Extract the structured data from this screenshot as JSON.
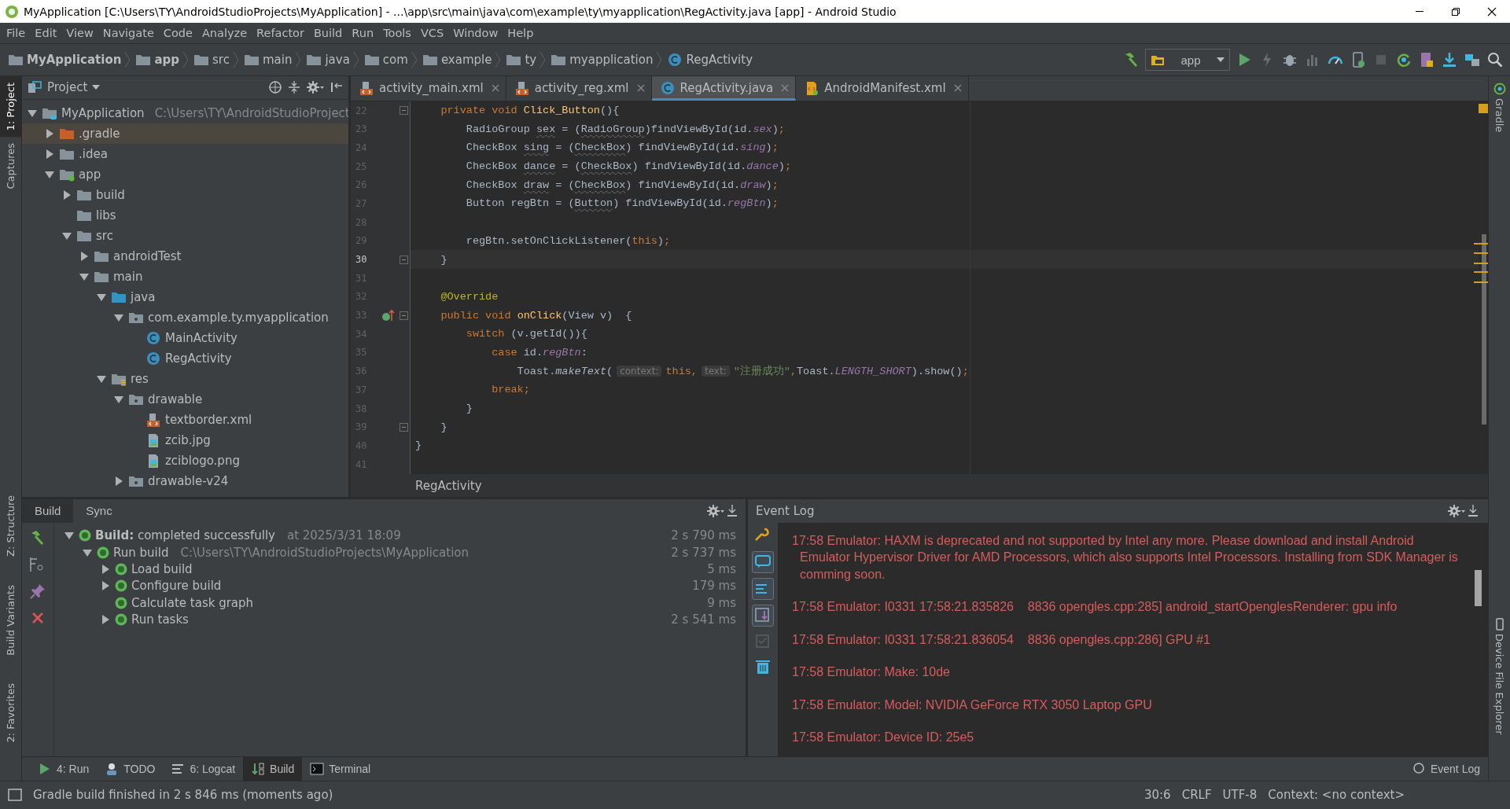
{
  "window": {
    "title": "MyApplication [C:\\Users\\TY\\AndroidStudioProjects\\MyApplication] - ...\\app\\src\\main\\java\\com\\example\\ty\\myapplication\\RegActivity.java [app] - Android Studio"
  },
  "menu": [
    "File",
    "Edit",
    "View",
    "Navigate",
    "Code",
    "Analyze",
    "Refactor",
    "Build",
    "Run",
    "Tools",
    "VCS",
    "Window",
    "Help"
  ],
  "breadcrumbs": [
    {
      "label": "MyApplication",
      "kind": "root"
    },
    {
      "label": "app",
      "kind": "module"
    },
    {
      "label": "src",
      "kind": "folder"
    },
    {
      "label": "main",
      "kind": "folder"
    },
    {
      "label": "java",
      "kind": "folder"
    },
    {
      "label": "com",
      "kind": "folder"
    },
    {
      "label": "example",
      "kind": "folder"
    },
    {
      "label": "ty",
      "kind": "folder"
    },
    {
      "label": "myapplication",
      "kind": "folder"
    },
    {
      "label": "RegActivity",
      "kind": "class"
    }
  ],
  "run_configuration": "app",
  "left_stripe": {
    "top": [
      {
        "label": "1: Project",
        "selected": true
      },
      {
        "label": "Captures",
        "selected": false
      }
    ],
    "bottom": [
      {
        "label": "Z: Structure",
        "selected": false
      },
      {
        "label": "Build Variants",
        "selected": false
      },
      {
        "label": "2: Favorites",
        "selected": false
      }
    ]
  },
  "right_stripe": [
    {
      "label": "Gradle"
    },
    {
      "label": "Device File Explorer"
    }
  ],
  "project": {
    "title": "Project",
    "tree": [
      {
        "label": "MyApplication",
        "path": "C:\\Users\\TY\\AndroidStudioProject",
        "kind": "root",
        "expanded": true,
        "selected": false,
        "children": [
          {
            "label": ".gradle",
            "kind": "folder-excluded",
            "expanded": false,
            "selected": true
          },
          {
            "label": ".idea",
            "kind": "folder",
            "expanded": false,
            "selected": false
          },
          {
            "label": "app",
            "kind": "module",
            "expanded": true,
            "selected": false,
            "children": [
              {
                "label": "build",
                "kind": "folder",
                "expanded": false,
                "selected": false
              },
              {
                "label": "libs",
                "kind": "folder",
                "selected": false
              },
              {
                "label": "src",
                "kind": "folder",
                "expanded": true,
                "selected": false,
                "children": [
                  {
                    "label": "androidTest",
                    "kind": "folder",
                    "expanded": false,
                    "selected": false
                  },
                  {
                    "label": "main",
                    "kind": "folder",
                    "expanded": true,
                    "selected": false,
                    "children": [
                      {
                        "label": "java",
                        "kind": "folder-source",
                        "expanded": true,
                        "selected": false,
                        "children": [
                          {
                            "label": "com.example.ty.myapplication",
                            "kind": "package",
                            "expanded": true,
                            "selected": false,
                            "children": [
                              {
                                "label": "MainActivity",
                                "kind": "class",
                                "selected": false
                              },
                              {
                                "label": "RegActivity",
                                "kind": "class",
                                "selected": false
                              }
                            ]
                          }
                        ]
                      },
                      {
                        "label": "res",
                        "kind": "folder-res",
                        "expanded": true,
                        "selected": false,
                        "children": [
                          {
                            "label": "drawable",
                            "kind": "package",
                            "expanded": true,
                            "selected": false,
                            "children": [
                              {
                                "label": "textborder.xml",
                                "kind": "xml",
                                "selected": false
                              },
                              {
                                "label": "zcib.jpg",
                                "kind": "image",
                                "selected": false
                              },
                              {
                                "label": "zciblogo.png",
                                "kind": "image",
                                "selected": false
                              }
                            ]
                          },
                          {
                            "label": "drawable-v24",
                            "kind": "package",
                            "expanded": false,
                            "selected": false
                          }
                        ]
                      }
                    ]
                  }
                ]
              }
            ]
          }
        ]
      }
    ]
  },
  "editor": {
    "tabs": [
      {
        "label": "activity_main.xml",
        "kind": "layout",
        "selected": false
      },
      {
        "label": "activity_reg.xml",
        "kind": "layout",
        "selected": false
      },
      {
        "label": "RegActivity.java",
        "kind": "class",
        "selected": true
      },
      {
        "label": "AndroidManifest.xml",
        "kind": "manifest",
        "selected": false
      }
    ],
    "lines": [
      {
        "number": "22",
        "current": false,
        "fold": true,
        "override": false,
        "tokens": [
          {
            "kind": "kw",
            "text": "    private void "
          },
          {
            "kind": "decl",
            "text": "Click_Button"
          },
          {
            "kind": "plain",
            "text": "(){"
          }
        ]
      },
      {
        "number": "23",
        "current": false,
        "fold": false,
        "override": false,
        "tokens": [
          {
            "kind": "plain",
            "text": "        RadioGroup "
          },
          {
            "kind": "unused",
            "text": "sex"
          },
          {
            "kind": "plain",
            "text": " = ("
          },
          {
            "kind": "unused",
            "text": "RadioGroup"
          },
          {
            "kind": "plain",
            "text": ")findViewById(id."
          },
          {
            "kind": "field",
            "text": "sex"
          },
          {
            "kind": "plain",
            "text": ")"
          },
          {
            "kind": "kw",
            "text": ";"
          }
        ]
      },
      {
        "number": "24",
        "current": false,
        "fold": false,
        "override": false,
        "tokens": [
          {
            "kind": "plain",
            "text": "        CheckBox "
          },
          {
            "kind": "unused",
            "text": "sing"
          },
          {
            "kind": "plain",
            "text": " = ("
          },
          {
            "kind": "unused",
            "text": "CheckBox"
          },
          {
            "kind": "plain",
            "text": ") findViewById(id."
          },
          {
            "kind": "field",
            "text": "sing"
          },
          {
            "kind": "plain",
            "text": ")"
          },
          {
            "kind": "kw",
            "text": ";"
          }
        ]
      },
      {
        "number": "25",
        "current": false,
        "fold": false,
        "override": false,
        "tokens": [
          {
            "kind": "plain",
            "text": "        CheckBox "
          },
          {
            "kind": "unused",
            "text": "dance"
          },
          {
            "kind": "plain",
            "text": " = ("
          },
          {
            "kind": "unused",
            "text": "CheckBox"
          },
          {
            "kind": "plain",
            "text": ") findViewById(id."
          },
          {
            "kind": "field",
            "text": "dance"
          },
          {
            "kind": "plain",
            "text": ")"
          },
          {
            "kind": "kw",
            "text": ";"
          }
        ]
      },
      {
        "number": "26",
        "current": false,
        "fold": false,
        "override": false,
        "tokens": [
          {
            "kind": "plain",
            "text": "        CheckBox "
          },
          {
            "kind": "unused",
            "text": "draw"
          },
          {
            "kind": "plain",
            "text": " = ("
          },
          {
            "kind": "unused",
            "text": "CheckBox"
          },
          {
            "kind": "plain",
            "text": ") findViewById(id."
          },
          {
            "kind": "field",
            "text": "draw"
          },
          {
            "kind": "plain",
            "text": ")"
          },
          {
            "kind": "kw",
            "text": ";"
          }
        ]
      },
      {
        "number": "27",
        "current": false,
        "fold": false,
        "override": false,
        "tokens": [
          {
            "kind": "plain",
            "text": "        Button regBtn = ("
          },
          {
            "kind": "unused",
            "text": "Button"
          },
          {
            "kind": "plain",
            "text": ") findViewById(id."
          },
          {
            "kind": "field",
            "text": "regBtn"
          },
          {
            "kind": "plain",
            "text": ")"
          },
          {
            "kind": "kw",
            "text": ";"
          }
        ]
      },
      {
        "number": "28",
        "current": false,
        "fold": false,
        "override": false
      },
      {
        "number": "29",
        "current": false,
        "fold": false,
        "override": false,
        "tokens": [
          {
            "kind": "plain",
            "text": "        regBtn.setOnClickListener("
          },
          {
            "kind": "kw",
            "text": "this"
          },
          {
            "kind": "plain",
            "text": ")"
          },
          {
            "kind": "kw",
            "text": ";"
          }
        ]
      },
      {
        "number": "30",
        "current": true,
        "fold": true,
        "override": false,
        "tokens": [
          {
            "kind": "plain",
            "text": "    }"
          }
        ]
      },
      {
        "number": "31",
        "current": false,
        "fold": false,
        "override": false
      },
      {
        "number": "32",
        "current": false,
        "fold": false,
        "override": false,
        "tokens": [
          {
            "kind": "anno",
            "text": "    @Override"
          }
        ]
      },
      {
        "number": "33",
        "current": false,
        "fold": true,
        "override": true,
        "tokens": [
          {
            "kind": "kw",
            "text": "    public void "
          },
          {
            "kind": "decl",
            "text": "onClick"
          },
          {
            "kind": "plain",
            "text": "(View v)  {"
          }
        ]
      },
      {
        "number": "34",
        "current": false,
        "fold": false,
        "override": false,
        "tokens": [
          {
            "kind": "kw",
            "text": "        switch"
          },
          {
            "kind": "plain",
            "text": " (v.getId()){"
          }
        ]
      },
      {
        "number": "35",
        "current": false,
        "fold": false,
        "override": false,
        "tokens": [
          {
            "kind": "kw",
            "text": "            case"
          },
          {
            "kind": "plain",
            "text": " id."
          },
          {
            "kind": "field",
            "text": "regBtn"
          },
          {
            "kind": "plain",
            "text": ":"
          }
        ]
      },
      {
        "number": "36",
        "current": false,
        "fold": false,
        "override": false,
        "tokens": [
          {
            "kind": "plain",
            "text": "                Toast."
          },
          {
            "kind": "static",
            "text": "makeText"
          },
          {
            "kind": "plain",
            "text": "("
          },
          {
            "kind": "hint",
            "text": "context:"
          },
          {
            "kind": "kw",
            "text": "this,"
          },
          {
            "kind": "hint",
            "text": "text:"
          },
          {
            "kind": "str",
            "text": "\"注册成功\""
          },
          {
            "kind": "kw",
            "text": ","
          },
          {
            "kind": "plain",
            "text": "Toast."
          },
          {
            "kind": "field",
            "text": "LENGTH_SHORT"
          },
          {
            "kind": "plain",
            "text": ").show()"
          },
          {
            "kind": "kw",
            "text": ";"
          }
        ]
      },
      {
        "number": "37",
        "current": false,
        "fold": false,
        "override": false,
        "tokens": [
          {
            "kind": "kw",
            "text": "            break;"
          }
        ]
      },
      {
        "number": "38",
        "current": false,
        "fold": false,
        "override": false,
        "tokens": [
          {
            "kind": "plain",
            "text": "        }"
          }
        ]
      },
      {
        "number": "39",
        "current": false,
        "fold": true,
        "override": false,
        "tokens": [
          {
            "kind": "plain",
            "text": "    }"
          }
        ]
      },
      {
        "number": "40",
        "current": false,
        "fold": false,
        "override": false,
        "tokens": [
          {
            "kind": "plain",
            "text": "}"
          }
        ]
      },
      {
        "number": "41",
        "current": false,
        "fold": false,
        "override": false
      }
    ],
    "breadcrumb": "RegActivity"
  },
  "build_panel": {
    "tabs": [
      {
        "label": "Build",
        "selected": true
      },
      {
        "label": "Sync",
        "selected": false
      }
    ],
    "tree": [
      {
        "label": "**Build:** completed successfully",
        "detail": "at 2025/3/31 18:09",
        "time": "2 s 790 ms",
        "expanded": true,
        "children": [
          {
            "label": "Run build",
            "detail": "C:\\Users\\TY\\AndroidStudioProjects\\MyApplication",
            "time": "2 s 737 ms",
            "expanded": true,
            "children": [
              {
                "label": "Load build",
                "time": "5 ms",
                "expanded": false
              },
              {
                "label": "Configure build",
                "time": "179 ms",
                "expanded": false
              },
              {
                "label": "Calculate task graph",
                "time": "9 ms"
              },
              {
                "label": "Run tasks",
                "time": "2 s 541 ms",
                "expanded": false
              }
            ]
          }
        ]
      }
    ]
  },
  "event_log": {
    "title": "Event Log",
    "entries": [
      "17:58 Emulator: HAXM is deprecated and not supported by Intel any more. Please download and install Android Emulator Hypervisor Driver for AMD Processors, which also supports Intel Processors. Installing from SDK Manager is comming soon.",
      "17:58 Emulator: I0331 17:58:21.835826    8836 opengles.cpp:285] android_startOpenglesRenderer: gpu info",
      "17:58 Emulator: I0331 17:58:21.836054    8836 opengles.cpp:286] GPU #1",
      "17:58 Emulator: Make: 10de",
      "17:58 Emulator: Model: NVIDIA GeForce RTX 3050 Laptop GPU",
      "17:58 Emulator: Device ID: 25e5"
    ]
  },
  "tool_tabs": [
    {
      "label": "4: Run",
      "kind": "run",
      "selected": false
    },
    {
      "label": "TODO",
      "kind": "todo",
      "selected": false
    },
    {
      "label": "6: Logcat",
      "kind": "logcat",
      "selected": false
    },
    {
      "label": "Build",
      "kind": "build",
      "selected": true
    },
    {
      "label": "Terminal",
      "kind": "terminal",
      "selected": false
    }
  ],
  "event_log_tab": "Event Log",
  "status_bar": {
    "message": "Gradle build finished in 2 s 846 ms (moments ago)",
    "position": "30:6",
    "line_separator": "CRLF",
    "encoding": "UTF-8",
    "context": "Context: <no context>"
  }
}
